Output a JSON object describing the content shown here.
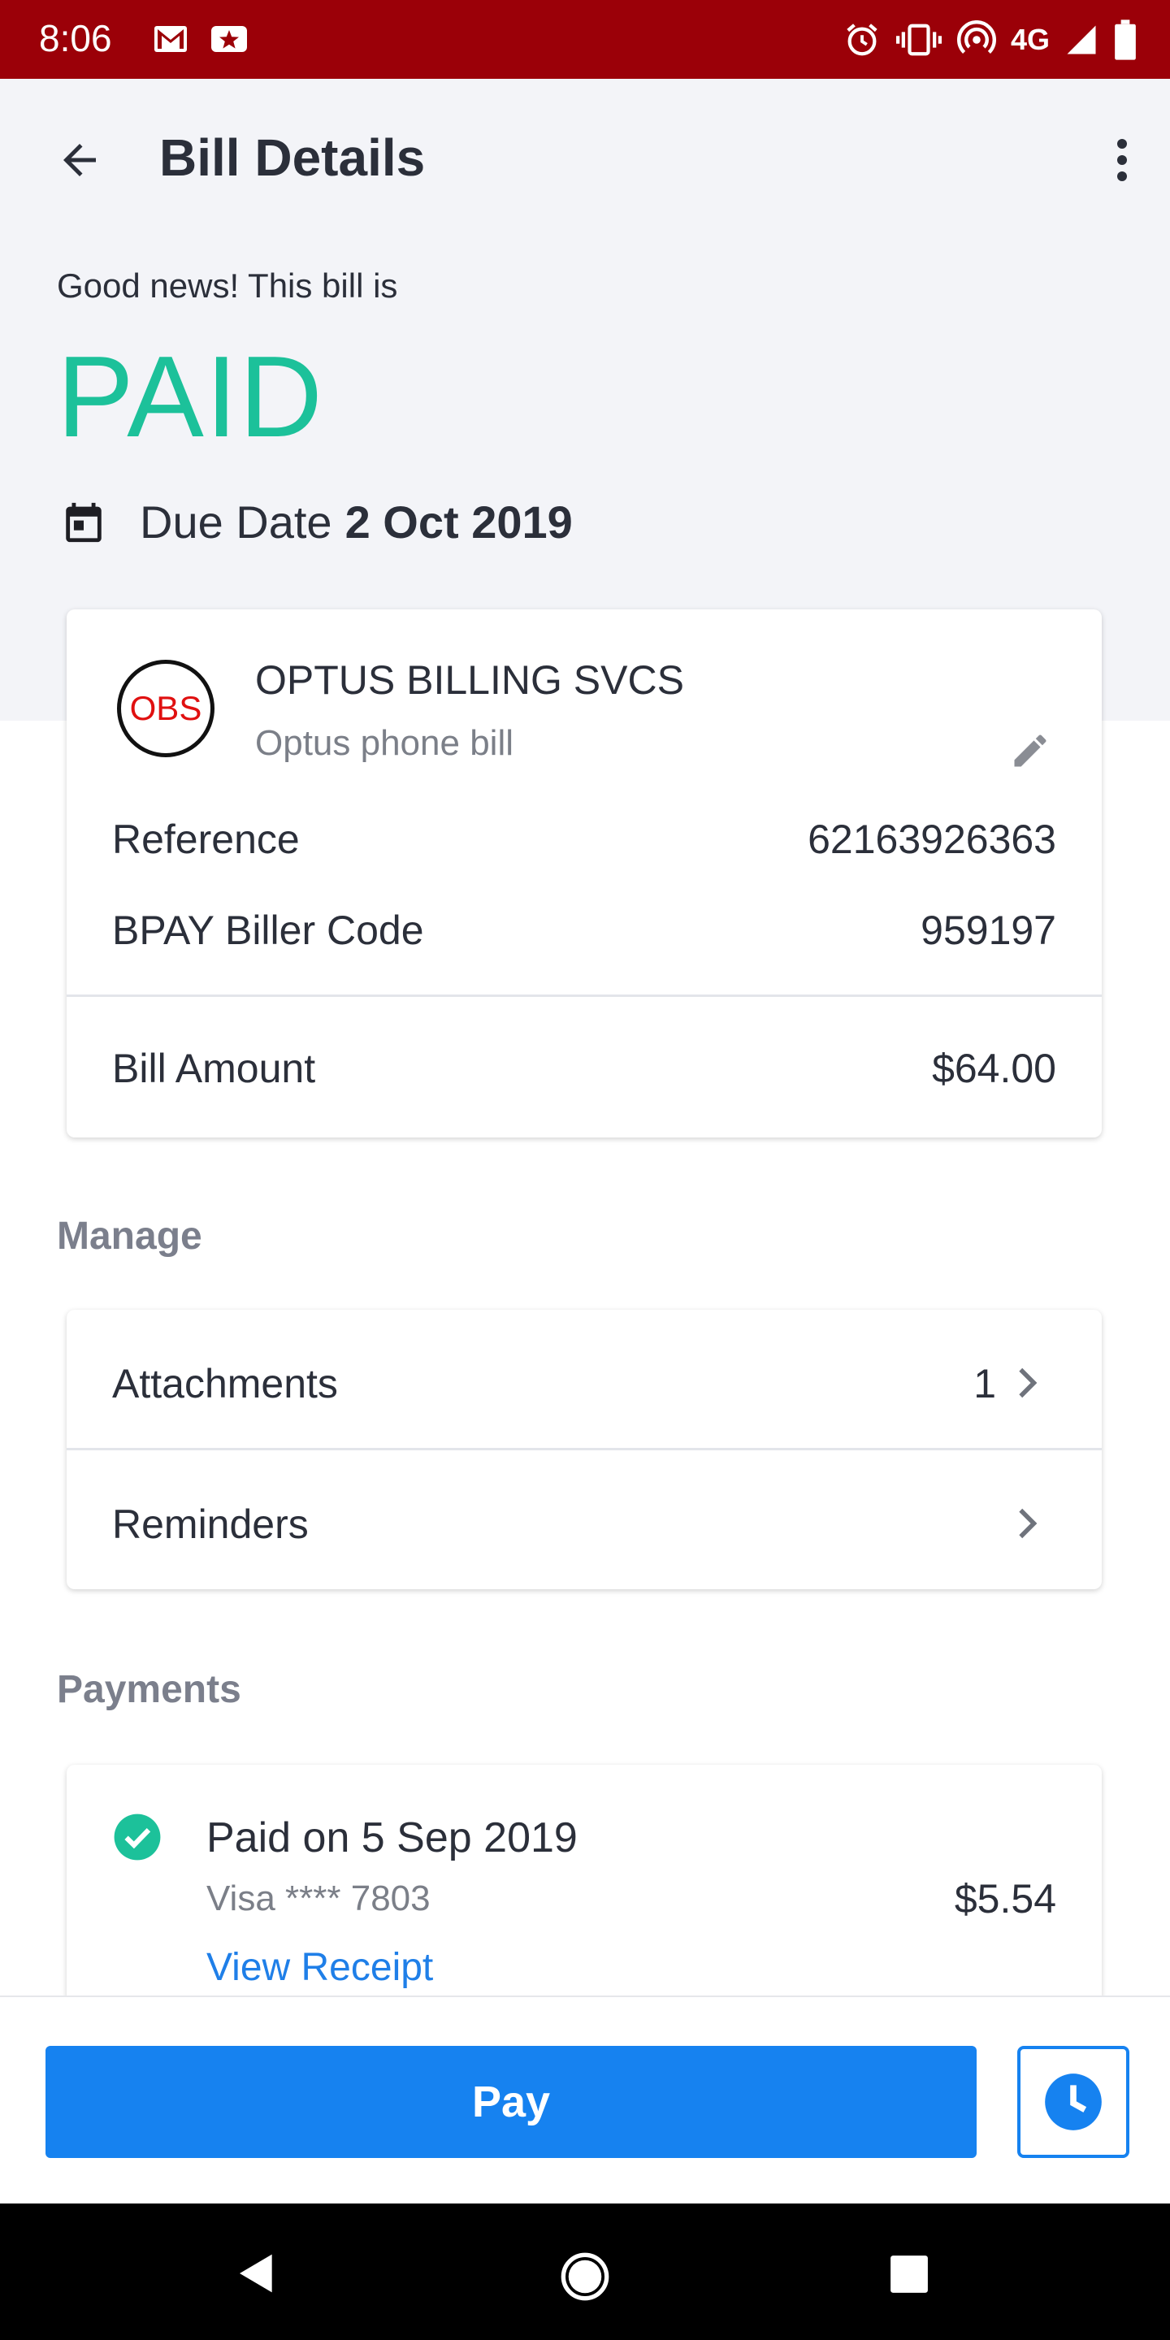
{
  "status_bar": {
    "time": "8:06",
    "network": "4G",
    "left_icons": [
      "gmail-icon",
      "star-app-icon"
    ],
    "right_icons": [
      "alarm-icon",
      "vibrate-icon",
      "hotspot-icon",
      "signal-icon",
      "battery-icon"
    ],
    "background": "#9b0008"
  },
  "header": {
    "title": "Bill Details"
  },
  "status": {
    "intro": "Good news! This bill is",
    "state": "PAID",
    "state_color": "#1cc19a",
    "due_label": "Due Date",
    "due_value": "2 Oct 2019"
  },
  "bill_card": {
    "logo_text": "OBS",
    "biller_name": "OPTUS BILLING SVCS",
    "nickname": "Optus phone bill",
    "reference_label": "Reference",
    "reference_value": "62163926363",
    "biller_code_label": "BPAY Biller Code",
    "biller_code_value": "959197",
    "amount_label": "Bill Amount",
    "amount_value": "$64.00"
  },
  "manage": {
    "title": "Manage",
    "attachments_label": "Attachments",
    "attachments_count": "1",
    "reminders_label": "Reminders"
  },
  "payments": {
    "title": "Payments",
    "items": [
      {
        "status": "Paid on 5 Sep 2019",
        "method": "Visa **** 7803",
        "amount": "$5.54",
        "receipt_link": "View Receipt"
      }
    ]
  },
  "actions": {
    "pay_label": "Pay",
    "accent": "#1682f0"
  }
}
